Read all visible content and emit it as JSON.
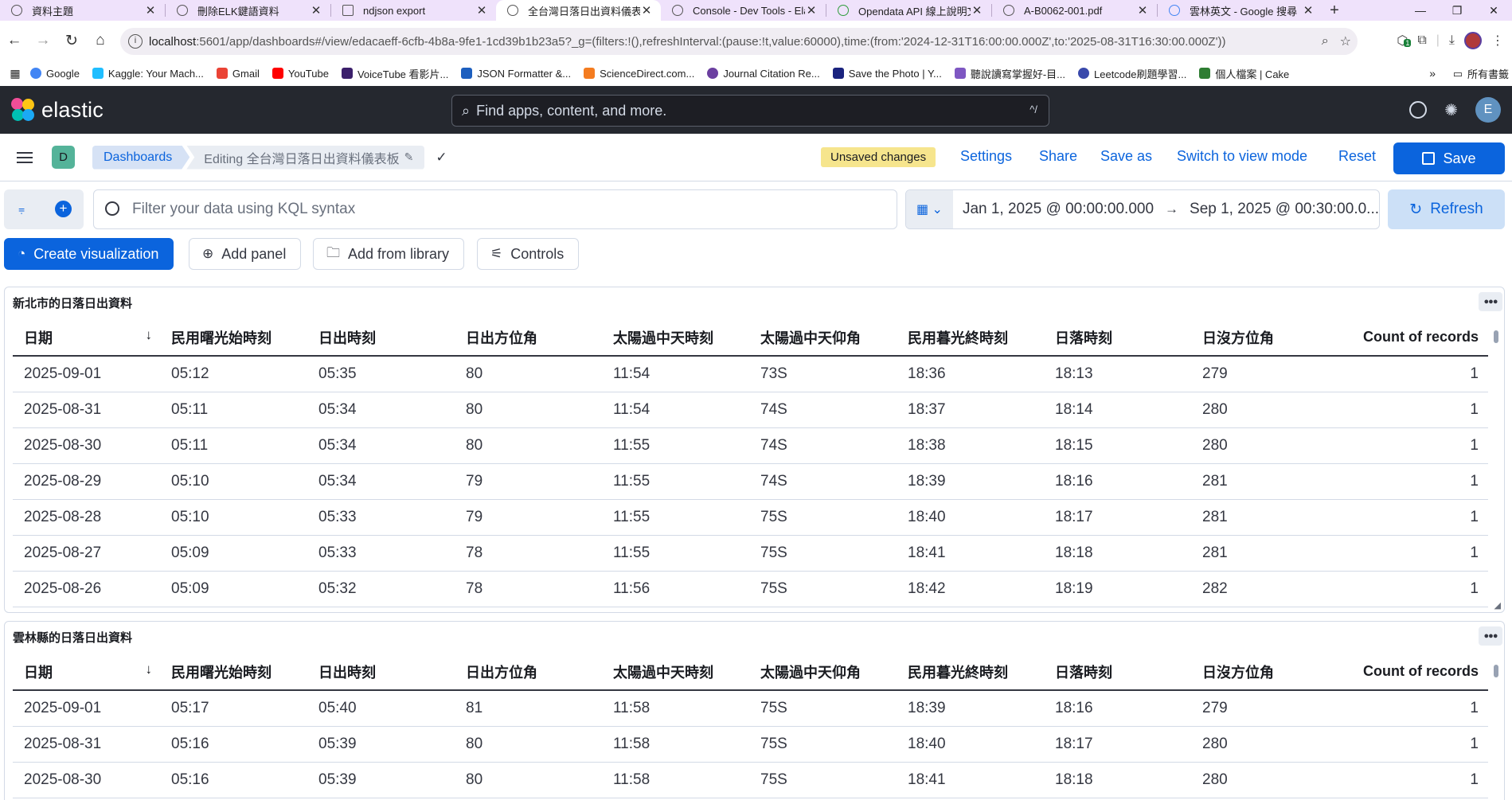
{
  "browser": {
    "tabs": [
      {
        "title": "資料主題",
        "active": false
      },
      {
        "title": "刪除ELK鍵語資料",
        "active": false
      },
      {
        "title": "ndjson export",
        "active": false
      },
      {
        "title": "全台灣日落日出資料儀表板",
        "active": true
      },
      {
        "title": "Console - Dev Tools - Elastic",
        "active": false
      },
      {
        "title": "Opendata API 線上說明文件",
        "active": false
      },
      {
        "title": "A-B0062-001.pdf",
        "active": false
      },
      {
        "title": "雲林英文 - Google 搜尋",
        "active": false
      }
    ],
    "url_host": "localhost",
    "url_path": ":5601/app/dashboards#/view/edacaeff-6cfb-4b8a-9fe1-1cd39b1b23a5?_g=(filters:!(),refreshInterval:(pause:!t,value:60000),time:(from:'2024-12-31T16:00:00.000Z',to:'2025-08-31T16:30:00.000Z'))",
    "extension_badge": "1",
    "bookmarks": [
      {
        "label": "Google",
        "color": "#4285f4"
      },
      {
        "label": "Kaggle: Your Mach...",
        "color": "#20beff"
      },
      {
        "label": "Gmail",
        "color": "#ea4335"
      },
      {
        "label": "YouTube",
        "color": "#ff0000"
      },
      {
        "label": "VoiceTube 看影片...",
        "color": "#3b1f6b"
      },
      {
        "label": "JSON Formatter &...",
        "color": "#1d5fbf"
      },
      {
        "label": "ScienceDirect.com...",
        "color": "#f47c20"
      },
      {
        "label": "Journal Citation Re...",
        "color": "#6b3fa0"
      },
      {
        "label": "Save the Photo | Y...",
        "color": "#1a237e"
      },
      {
        "label": "聽說讀寫掌握好-目...",
        "color": "#7e57c2"
      },
      {
        "label": "Leetcode刷題學習...",
        "color": "#3949ab"
      },
      {
        "label": "個人檔案 | Cake",
        "color": "#2e7d32"
      }
    ],
    "bookmarks_more": "»",
    "all_bookmarks": "所有書籤"
  },
  "kibana": {
    "brand": "elastic",
    "search_placeholder": "Find apps, content, and more.",
    "search_shortcut": "^/",
    "user_initial": "E",
    "space_initial": "D",
    "breadcrumb": {
      "root": "Dashboards",
      "current": "Editing 全台灣日落日出資料儀表板"
    },
    "unsaved_label": "Unsaved changes",
    "nav": {
      "settings": "Settings",
      "share": "Share",
      "save_as": "Save as",
      "switch_view": "Switch to view mode",
      "reset": "Reset",
      "save": "Save"
    },
    "query": {
      "placeholder": "Filter your data using KQL syntax",
      "date_from": "Jan 1, 2025 @ 00:00:00.000",
      "date_to": "Sep 1, 2025 @ 00:30:00.0...",
      "refresh": "Refresh"
    },
    "panel_toolbar": {
      "create": "Create visualization",
      "add_panel": "Add panel",
      "add_library": "Add from library",
      "controls": "Controls"
    },
    "columns": [
      "日期",
      "民用曙光始時刻",
      "日出時刻",
      "日出方位角",
      "太陽過中天時刻",
      "太陽過中天仰角",
      "民用暮光終時刻",
      "日落時刻",
      "日沒方位角",
      "Count of records"
    ],
    "panels": [
      {
        "title": "新北市的日落日出資料",
        "rows": [
          [
            "2025-09-01",
            "05:12",
            "05:35",
            "80",
            "11:54",
            "73S",
            "18:36",
            "18:13",
            "279",
            "1"
          ],
          [
            "2025-08-31",
            "05:11",
            "05:34",
            "80",
            "11:54",
            "74S",
            "18:37",
            "18:14",
            "280",
            "1"
          ],
          [
            "2025-08-30",
            "05:11",
            "05:34",
            "80",
            "11:55",
            "74S",
            "18:38",
            "18:15",
            "280",
            "1"
          ],
          [
            "2025-08-29",
            "05:10",
            "05:34",
            "79",
            "11:55",
            "74S",
            "18:39",
            "18:16",
            "281",
            "1"
          ],
          [
            "2025-08-28",
            "05:10",
            "05:33",
            "79",
            "11:55",
            "75S",
            "18:40",
            "18:17",
            "281",
            "1"
          ],
          [
            "2025-08-27",
            "05:09",
            "05:33",
            "78",
            "11:55",
            "75S",
            "18:41",
            "18:18",
            "281",
            "1"
          ],
          [
            "2025-08-26",
            "05:09",
            "05:32",
            "78",
            "11:56",
            "75S",
            "18:42",
            "18:19",
            "282",
            "1"
          ]
        ]
      },
      {
        "title": "雲林縣的日落日出資料",
        "rows": [
          [
            "2025-09-01",
            "05:17",
            "05:40",
            "81",
            "11:58",
            "75S",
            "18:39",
            "18:16",
            "279",
            "1"
          ],
          [
            "2025-08-31",
            "05:16",
            "05:39",
            "80",
            "11:58",
            "75S",
            "18:40",
            "18:17",
            "280",
            "1"
          ],
          [
            "2025-08-30",
            "05:16",
            "05:39",
            "80",
            "11:58",
            "75S",
            "18:41",
            "18:18",
            "280",
            "1"
          ]
        ]
      }
    ]
  }
}
